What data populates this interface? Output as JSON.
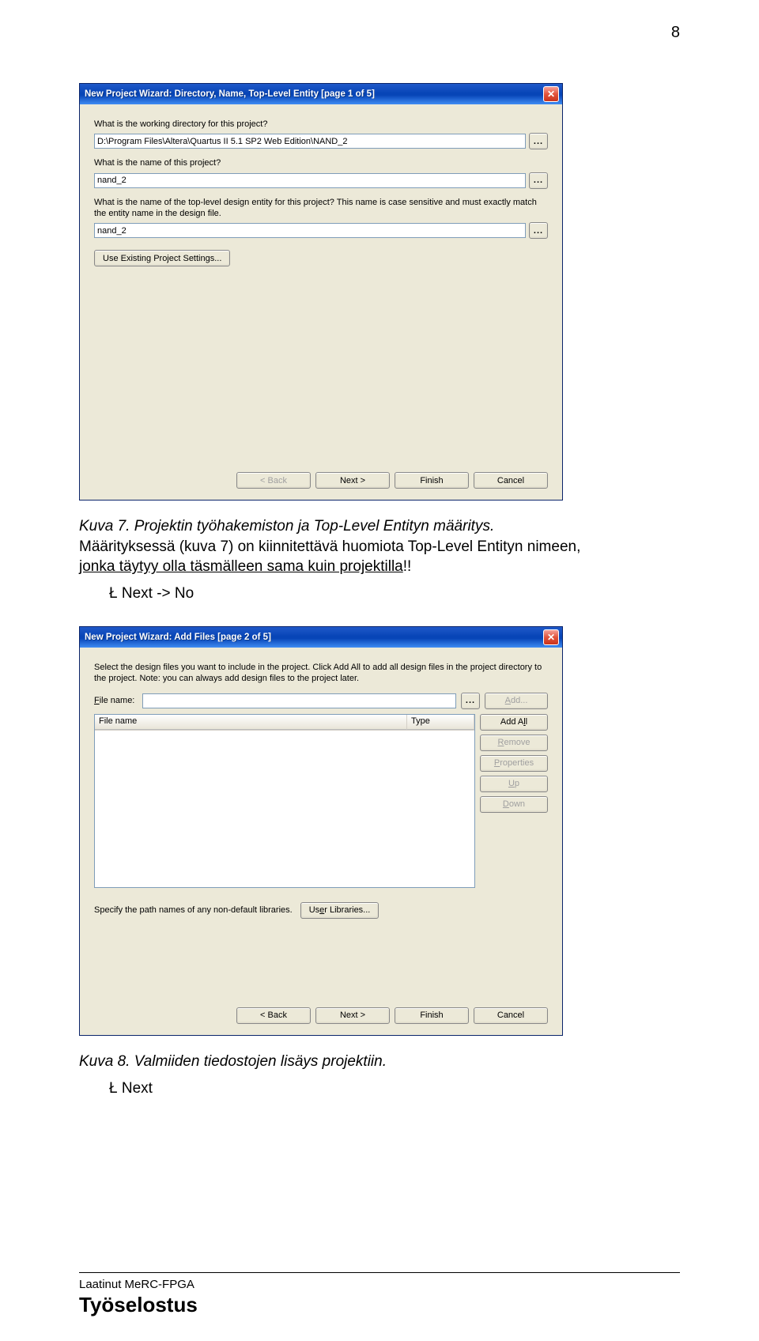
{
  "page_number": "8",
  "dialog1": {
    "title": "New Project Wizard: Directory, Name, Top-Level Entity [page 1 of 5]",
    "q1": "What is the working directory for this project?",
    "dir_value": "D:\\Program Files\\Altera\\Quartus II 5.1 SP2 Web Edition\\NAND_2",
    "q2": "What is the name of this project?",
    "name_value": "nand_2",
    "q3": "What is the name of the top-level design entity for this project? This name is case sensitive and must exactly match the entity name in the design file.",
    "entity_value": "nand_2",
    "browse": "...",
    "use_existing": "Use Existing Project Settings...",
    "buttons": {
      "back": "< Back",
      "next": "Next >",
      "finish": "Finish",
      "cancel": "Cancel"
    }
  },
  "caption1_prefix": "Kuva 7. Projektin työhakemiston ja Top-Level Entityn  määritys.",
  "caption1_line2a": "Määrityksessä (kuva 7) on kiinnitettävä huomiota Top-Level Entityn nimeen,",
  "caption1_line3": "jonka täytyy olla täsmälleen sama kuin projektilla",
  "caption1_excl": "!!",
  "bullet1": "Ł   Next -> No",
  "dialog2": {
    "title": "New Project Wizard: Add Files [page 2 of 5]",
    "desc": "Select the design files you want to include in the project. Click Add All to add all design files in the project directory to the project. Note: you can always add design files to the project later.",
    "file_label": "File name:",
    "file_value": "",
    "browse": "...",
    "col_name": "File name",
    "col_type": "Type",
    "side": {
      "add": "Add...",
      "addall": "Add All",
      "remove": "Remove",
      "props": "Properties",
      "up": "Up",
      "down": "Down"
    },
    "specify": "Specify the path names of any non-default libraries.",
    "userlib": "User Libraries...",
    "buttons": {
      "back": "< Back",
      "next": "Next >",
      "finish": "Finish",
      "cancel": "Cancel"
    }
  },
  "caption2": "Kuva 8. Valmiiden tiedostojen lisäys projektiin.",
  "bullet2": "Ł   Next",
  "footer_small": "Laatinut MeRC-FPGA",
  "footer_big": "Työselostus"
}
